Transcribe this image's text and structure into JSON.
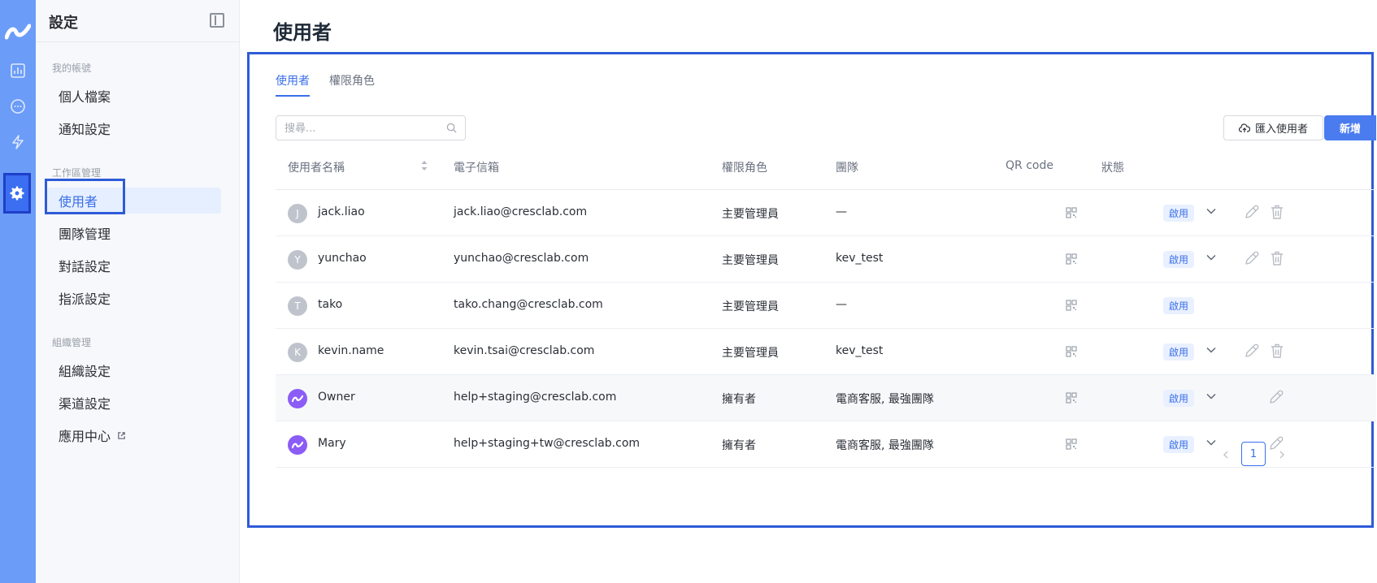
{
  "sidebar": {
    "title": "設定",
    "groups": [
      {
        "title": "我的帳號",
        "items": [
          "個人檔案",
          "通知設定"
        ]
      },
      {
        "title": "工作區管理",
        "items": [
          "使用者",
          "團隊管理",
          "對話設定",
          "指派設定"
        ]
      },
      {
        "title": "組織管理",
        "items": [
          "組織設定",
          "渠道設定",
          "應用中心"
        ]
      }
    ],
    "active_item": "使用者"
  },
  "main": {
    "page_title": "使用者",
    "tabs": [
      {
        "label": "使用者",
        "active": true
      },
      {
        "label": "權限角色",
        "active": false
      }
    ],
    "search": {
      "placeholder": "搜尋..."
    },
    "import_button": "匯入使用者",
    "add_button": "新增",
    "table": {
      "columns": [
        "使用者名稱",
        "電子信箱",
        "權限角色",
        "團隊",
        "QR code",
        "狀態"
      ],
      "rows": [
        {
          "initial": "J",
          "name": "jack.liao",
          "email": "jack.liao@cresclab.com",
          "role": "主要管理員",
          "team": "—",
          "status": "啟用",
          "dropdown": true,
          "edit": true,
          "delete": true
        },
        {
          "initial": "Y",
          "name": "yunchao",
          "email": "yunchao@cresclab.com",
          "role": "主要管理員",
          "team": "kev_test",
          "status": "啟用",
          "dropdown": true,
          "edit": true,
          "delete": true
        },
        {
          "initial": "T",
          "name": "tako",
          "email": "tako.chang@cresclab.com",
          "role": "主要管理員",
          "team": "—",
          "status": "啟用",
          "dropdown": false,
          "edit": false,
          "delete": false
        },
        {
          "initial": "K",
          "name": "kevin.name",
          "email": "kevin.tsai@cresclab.com",
          "role": "主要管理員",
          "team": "kev_test",
          "status": "啟用",
          "dropdown": true,
          "edit": true,
          "delete": true
        },
        {
          "initial": "",
          "name": "Owner",
          "email": "help+staging@cresclab.com",
          "role": "擁有者",
          "team": "電商客服, 最強團隊",
          "status": "啟用",
          "dropdown": true,
          "edit": true,
          "delete": false,
          "owner": true
        },
        {
          "initial": "",
          "name": "Mary",
          "email": "help+staging+tw@cresclab.com",
          "role": "擁有者",
          "team": "電商客服, 最強團隊",
          "status": "啟用",
          "dropdown": true,
          "edit": true,
          "delete": false,
          "owner": true
        }
      ]
    },
    "pagination": {
      "current_page": "1"
    }
  },
  "colors": {
    "rail": "#6b9cf7",
    "accent": "#3a6fe8",
    "highlight_outline": "#2e5bd8",
    "owner_avatar": "#8b5cf6"
  },
  "icons": [
    "brand-logo-icon",
    "analytics-icon",
    "chat-icon",
    "automation-icon",
    "settings-icon",
    "collapse-sidebar-icon",
    "external-link-icon",
    "search-icon",
    "upload-cloud-icon",
    "sort-icon",
    "qr-code-icon",
    "chevron-down-icon",
    "edit-icon",
    "trash-icon",
    "chevron-left-icon",
    "chevron-right-icon"
  ]
}
